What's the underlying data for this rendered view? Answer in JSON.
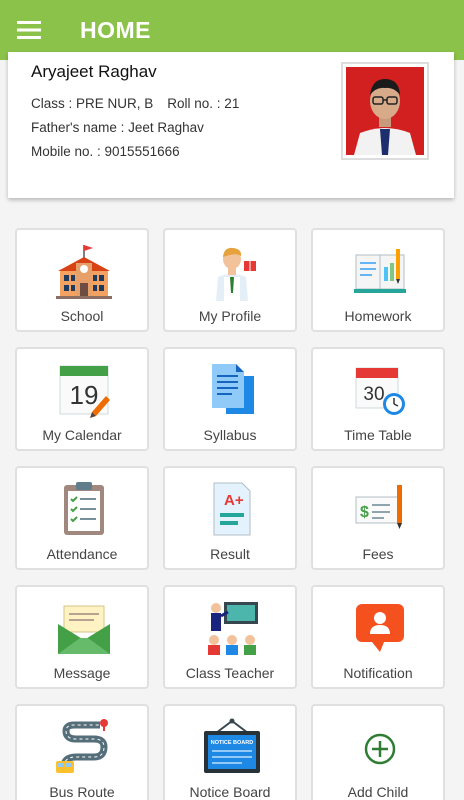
{
  "header": {
    "title": "HOME",
    "menu_icon": "hamburger-menu-icon",
    "color": "#8bc34a"
  },
  "student": {
    "name": "Aryajeet Raghav",
    "class_text": "Class : PRE NUR, B",
    "roll_text": "Roll no. : 21",
    "father_text": "Father's name : Jeet Raghav",
    "mobile_text": "Mobile no. : 9015551666"
  },
  "tiles": [
    {
      "label": "School",
      "icon": "school-building-icon"
    },
    {
      "label": "My Profile",
      "icon": "teacher-profile-icon"
    },
    {
      "label": "Homework",
      "icon": "homework-book-icon"
    },
    {
      "label": "My Calendar",
      "icon": "calendar-icon",
      "icon_text": "19"
    },
    {
      "label": "Syllabus",
      "icon": "syllabus-documents-icon"
    },
    {
      "label": "Time Table",
      "icon": "timetable-clock-icon",
      "icon_text": "30"
    },
    {
      "label": "Attendance",
      "icon": "attendance-clipboard-icon"
    },
    {
      "label": "Result",
      "icon": "result-report-icon",
      "icon_text": "A+"
    },
    {
      "label": "Fees",
      "icon": "fees-cheque-icon"
    },
    {
      "label": "Message",
      "icon": "message-envelope-icon"
    },
    {
      "label": "Class Teacher",
      "icon": "class-teacher-icon"
    },
    {
      "label": "Notification",
      "icon": "notification-bubble-icon"
    },
    {
      "label": "Bus Route",
      "icon": "bus-route-icon"
    },
    {
      "label": "Notice Board",
      "icon": "notice-board-icon",
      "icon_text": "NOTICE BOARD"
    },
    {
      "label": "Add Child",
      "icon": "add-child-plus-icon"
    }
  ]
}
